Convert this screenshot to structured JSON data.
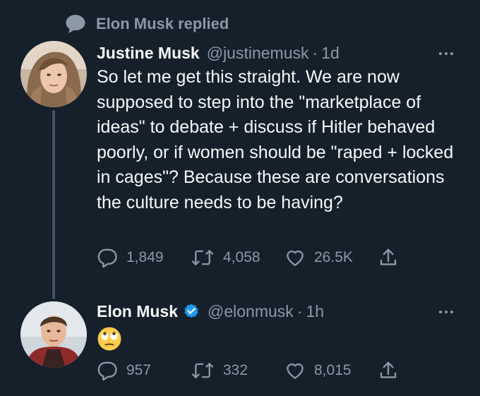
{
  "context": {
    "icon": "speech-bubble-icon",
    "text": "Elon Musk replied"
  },
  "parent_tweet": {
    "display_name": "Justine Musk",
    "handle": "@justinemusk",
    "separator": "·",
    "time": "1d",
    "text": "So let me get this straight. We are now supposed to step into the \"marketplace of ideas\" to debate + discuss if Hitler behaved poorly, or if women should be \"raped + locked in cages\"? Because these are conversations the culture needs to be having?",
    "replies": "1,849",
    "retweets": "4,058",
    "likes": "26.5K"
  },
  "reply_tweet": {
    "display_name": "Elon Musk",
    "verified": true,
    "handle": "@elonmusk",
    "separator": "·",
    "time": "1h",
    "content_emoji": "face-with-rolling-eyes",
    "replies": "957",
    "retweets": "332",
    "likes": "8,015"
  },
  "colors": {
    "background": "#15202b",
    "primary_text": "#f7f9f9",
    "secondary_text": "#8b98a5",
    "verified_blue": "#1d9bf0",
    "thread_line": "#3d5466"
  }
}
